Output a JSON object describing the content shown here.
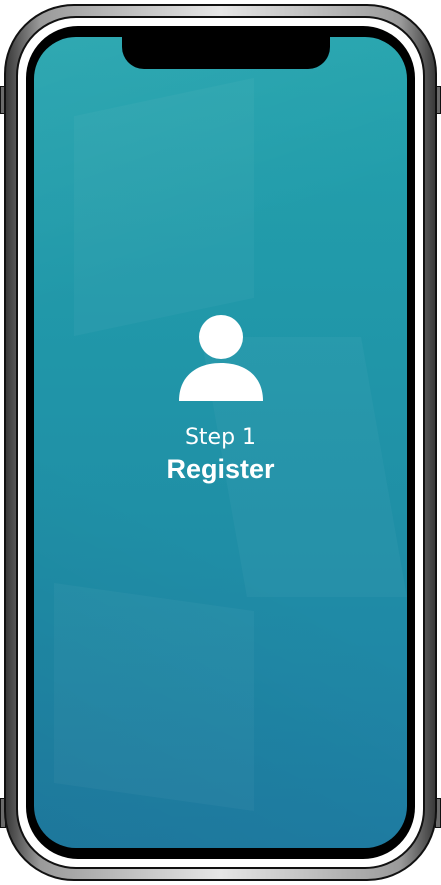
{
  "onboarding": {
    "step_label": "Step 1",
    "step_title": "Register",
    "icon": "user-icon"
  },
  "colors": {
    "screen_top": "#23a3ad",
    "screen_bottom": "#1f7ea5",
    "text": "#ffffff"
  }
}
